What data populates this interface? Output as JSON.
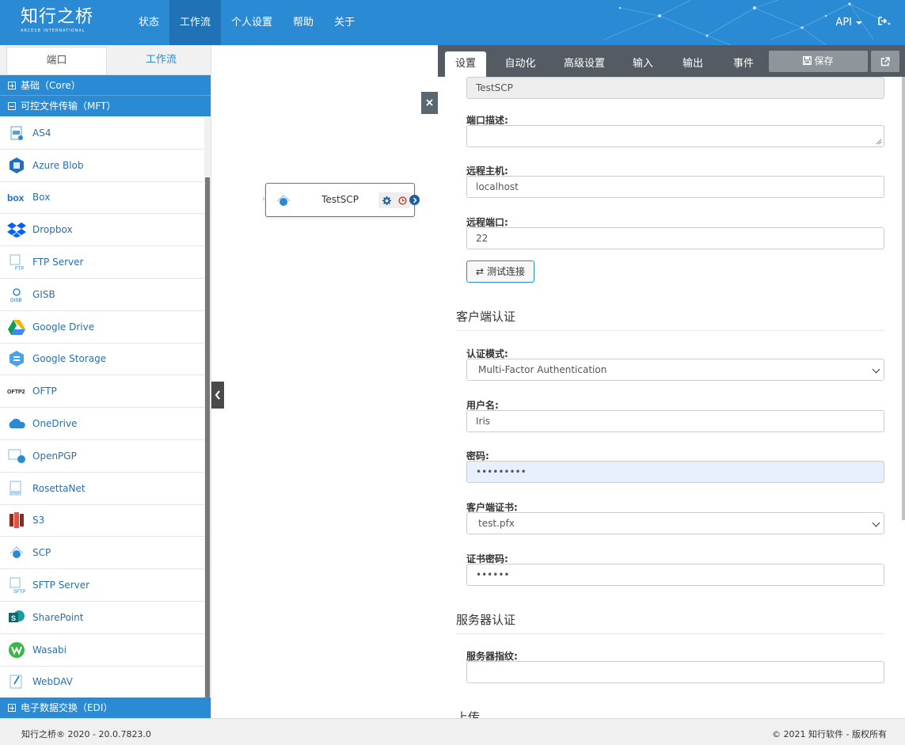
{
  "header": {
    "logo": "知行之桥",
    "logo_sub": "ARCESB INTERNATIONAL",
    "nav": [
      "状态",
      "工作流",
      "个人设置",
      "帮助",
      "关于"
    ],
    "active_nav": "工作流",
    "api_label": "API",
    "logout_icon": "sign-out-icon"
  },
  "left_panel": {
    "tabs": [
      "端口",
      "工作流"
    ],
    "active_tab": "端口",
    "categories": {
      "core": "基础（Core）",
      "mft": "可控文件传输（MFT）",
      "edi": "电子数据交换（EDI）"
    },
    "connectors": [
      {
        "label": "AS4",
        "icon": "as4-icon"
      },
      {
        "label": "Azure Blob",
        "icon": "azure-blob-icon"
      },
      {
        "label": "Box",
        "icon": "box-icon"
      },
      {
        "label": "Dropbox",
        "icon": "dropbox-icon"
      },
      {
        "label": "FTP Server",
        "icon": "ftp-server-icon"
      },
      {
        "label": "GISB",
        "icon": "gisb-icon"
      },
      {
        "label": "Google Drive",
        "icon": "google-drive-icon"
      },
      {
        "label": "Google Storage",
        "icon": "google-storage-icon"
      },
      {
        "label": "OFTP",
        "icon": "oftp-icon"
      },
      {
        "label": "OneDrive",
        "icon": "onedrive-icon"
      },
      {
        "label": "OpenPGP",
        "icon": "openpgp-icon"
      },
      {
        "label": "RosettaNet",
        "icon": "rosettanet-icon"
      },
      {
        "label": "S3",
        "icon": "s3-icon"
      },
      {
        "label": "SCP",
        "icon": "scp-icon"
      },
      {
        "label": "SFTP Server",
        "icon": "sftp-server-icon"
      },
      {
        "label": "SharePoint",
        "icon": "sharepoint-icon"
      },
      {
        "label": "Wasabi",
        "icon": "wasabi-icon"
      },
      {
        "label": "WebDAV",
        "icon": "webdav-icon"
      }
    ]
  },
  "canvas": {
    "node_name": "TestSCP"
  },
  "right_panel": {
    "tabs": [
      "设置",
      "自动化",
      "高级设置",
      "输入",
      "输出",
      "事件"
    ],
    "active_tab": "设置",
    "save_label": "保存",
    "port_id_value": "TestSCP",
    "port_desc_label": "端口描述:",
    "port_desc_value": "",
    "remote_host_label": "远程主机:",
    "remote_host_value": "localhost",
    "remote_port_label": "远程端口:",
    "remote_port_value": "22",
    "test_connection_label": "测试连接",
    "client_auth_section": "客户端认证",
    "auth_mode_label": "认证模式:",
    "auth_mode_value": "Multi-Factor Authentication",
    "username_label": "用户名:",
    "username_value": "Iris",
    "password_label": "密码:",
    "password_value": "•••••••••",
    "client_cert_label": "客户端证书:",
    "client_cert_value": "test.pfx",
    "cert_password_label": "证书密码:",
    "cert_password_value": "••••••",
    "server_auth_section": "服务器认证",
    "fingerprint_label": "服务器指纹:",
    "fingerprint_value": "",
    "upload_section": "上传"
  },
  "footer": {
    "left": "知行之桥® 2020 - 20.0.7823.0",
    "right": "© 2021 知行软件 - 版权所有"
  },
  "colors": {
    "brand_blue": "#2a8ad4",
    "tab_bar": "#545b62",
    "save_button": "#8e969c"
  }
}
